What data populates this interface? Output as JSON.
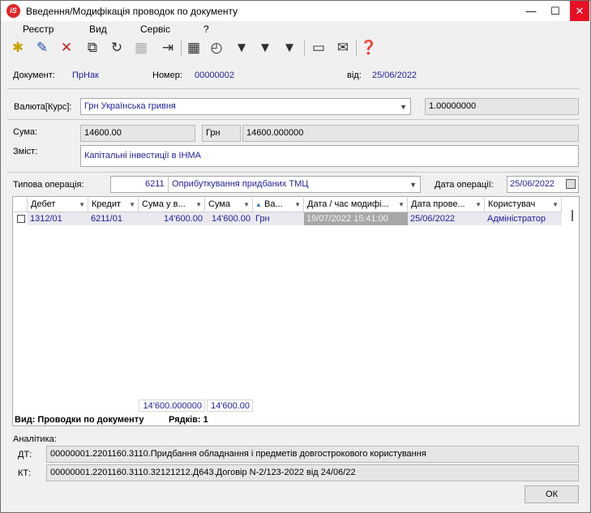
{
  "window": {
    "title": "Введення/Модифікація проводок по документу",
    "app_icon": "iS",
    "minimize": "—",
    "maximize": "☐",
    "close": "✕"
  },
  "menu": [
    "Реєстр",
    "Вид",
    "Сервіс",
    "?"
  ],
  "toolbar": [
    "new-icon",
    "edit-icon",
    "delete-icon",
    "copy-icon",
    "refresh-icon",
    "excel-disabled-icon",
    "export-icon",
    "table-icon",
    "history-icon",
    "filter-icon",
    "filter-plus-icon",
    "filter-clear-icon",
    "form-icon",
    "mail-icon",
    "help-icon"
  ],
  "header": {
    "doc_label": "Документ:",
    "doc_value": "ПрНак",
    "number_label": "Номер:",
    "number_value": "00000002",
    "date_label": "від:",
    "date_value": "25/06/2022"
  },
  "currency": {
    "label": "Валюта[Курс]:",
    "value": "Грн Українська гривня",
    "rate": "1.00000000"
  },
  "sum": {
    "label": "Сума:",
    "value": "14600.00",
    "currency": "Грн",
    "currency_value": "14600.000000"
  },
  "content": {
    "label": "Зміст:",
    "value": "Капітальні інвестиції в ІНМА"
  },
  "operation": {
    "label": "Типова операція:",
    "code": "6211",
    "name": "Оприбуткування придбаних ТМЦ",
    "date_label": "Дата операції:",
    "date_value": "25/06/2022"
  },
  "grid": {
    "columns": [
      "Дебет",
      "Кредит",
      "Сума у в...",
      "Сума",
      "Ва...",
      "Дата / час модифі...",
      "Дата прове...",
      "Користувач"
    ],
    "rows": [
      [
        "1312/01",
        "6211/01",
        "14'600.00",
        "14'600.00",
        "Грн",
        "19/07/2022 15:41:00",
        "25/06/2022",
        "Адміністратор"
      ]
    ],
    "totals": [
      "14'600.000000",
      "14'600.00"
    ],
    "view_label": "Вид: Проводки по документу",
    "rows_label": "Рядків: 1"
  },
  "analytics": {
    "label": "Аналітика:",
    "dt_label": "ДТ:",
    "dt_value": "00000001.2201160.3110.Придбання обладнання і предметів довгострокового користування",
    "kt_label": "КТ:",
    "kt_value": "00000001.2201160.3110.32121212.Д643.Договір N-2/123-2022 від 24/06/22"
  },
  "ok_label": "ОК"
}
